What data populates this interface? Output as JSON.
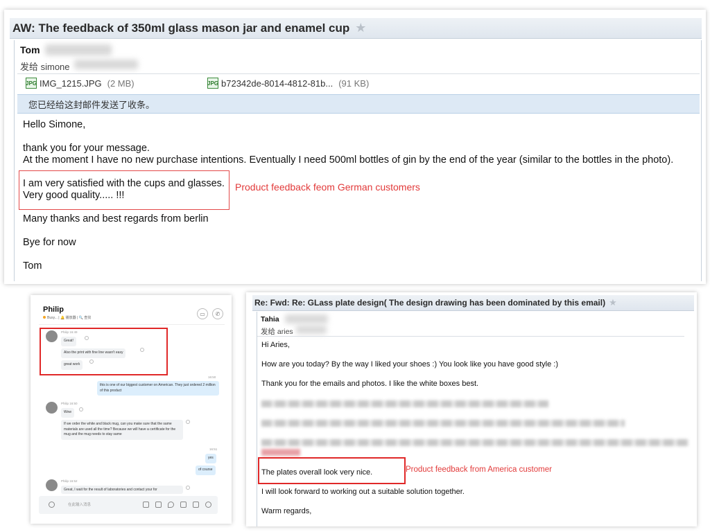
{
  "top_email": {
    "subject": "AW: The feedback of  350ml glass mason jar and enamel cup",
    "sender": "Tom",
    "to": "发给 simone",
    "attachments": [
      {
        "name": "IMG_1215.JPG",
        "size": "(2 MB)"
      },
      {
        "name": "b72342de-8014-4812-81b...",
        "size": "(91 KB)"
      }
    ],
    "notice": "您已经给这封邮件发送了收条。",
    "lines": {
      "greeting": "Hello Simone,",
      "l1": "thank you for your message.",
      "l2": "At the moment I have no new purchase intentions. Eventually I need 500ml bottles of gin by the end of the year (similar to the bottles in the photo).",
      "l3": "I am very satisfied with the cups and glasses.",
      "l4": "Very good quality..... !!!",
      "l5": "Many thanks and best regards from berlin",
      "l6": "Bye for now",
      "l7": "Tom"
    },
    "annotation": "Product feedback feom German customers"
  },
  "chat": {
    "contact": "Philip",
    "status": "Busy... | 🔔 播放器 | 🔍 查找",
    "messages": [
      {
        "meta": "Philip 16:49",
        "text": "Great!"
      },
      {
        "meta": "",
        "text": "Also the print with fine line wasn't easy"
      },
      {
        "meta": "",
        "text": "great work"
      },
      {
        "meta": "16:50",
        "text": "this is one of our biggest customer on American. They just ordered 2 million of this product"
      },
      {
        "meta": "Philip 16:50",
        "text": "Wow"
      },
      {
        "meta": "",
        "text": "If we order the white and black mug, can you make sure that the same materials are used all the time? Because we will have a certificate for the mug and the mug needs to stay same"
      },
      {
        "meta": "16:51",
        "text": "yes"
      },
      {
        "meta": "",
        "text": "of course"
      },
      {
        "meta": "Philip 16:52",
        "text": "Great, I wait for the result of laboratories and contact your for"
      }
    ],
    "input_placeholder": "在此输入消息"
  },
  "br_email": {
    "subject": "Re: Fwd: Re: GLass plate design( The design drawing has been dominated by this email)",
    "sender": "Tahia",
    "to": "发给 aries",
    "lines": {
      "l1": "Hi Aries,",
      "l2": "How are you today?  By the way I liked your shoes :) You look like you have good style :)",
      "l3": "Thank you for the emails and photos.  I like the white boxes best.",
      "l4": "The plates overall look very nice.",
      "l5": "I will look forward to working out a suitable solution together.",
      "l6": "Warm regards,"
    },
    "annotation": "Product feedback from America customer"
  },
  "colors": {
    "annotation_red": "#e23a3a",
    "notice_bg": "#dde9f5",
    "title_bar": "#e6ebf1"
  }
}
